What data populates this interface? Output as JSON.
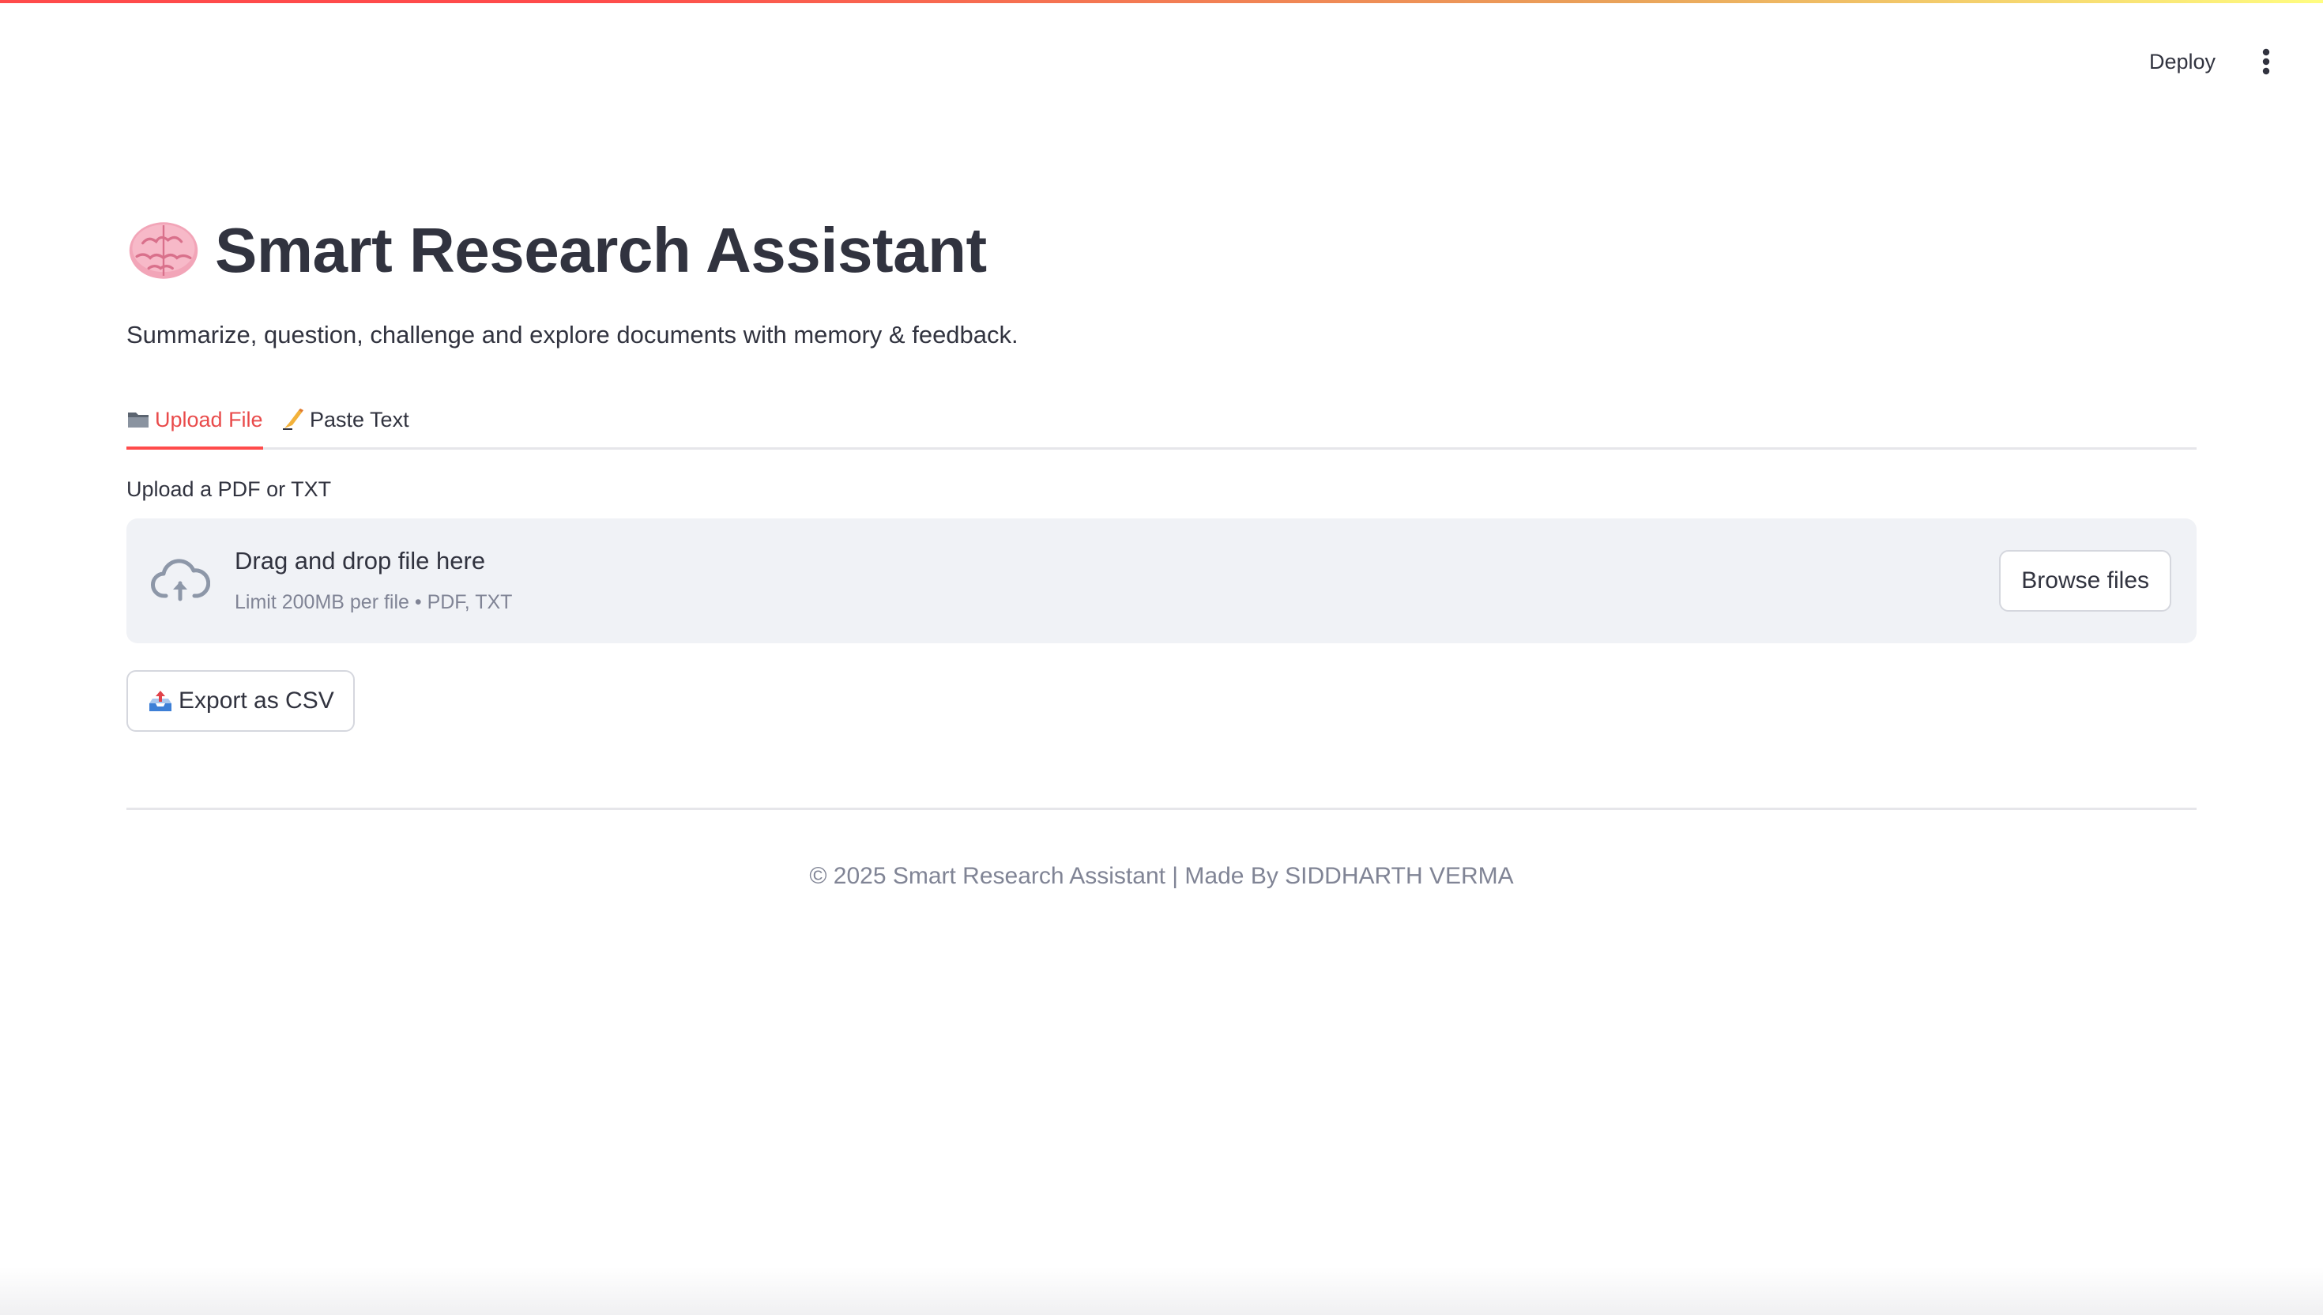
{
  "header": {
    "deploy_label": "Deploy",
    "menu_icon": "more-vertical-icon"
  },
  "app": {
    "title_icon": "brain-icon",
    "title": "Smart Research Assistant",
    "subtitle": "Summarize, question, challenge and explore documents with memory & feedback."
  },
  "tabs": [
    {
      "icon": "folder-icon",
      "label": "Upload File",
      "active": true
    },
    {
      "icon": "writing-hand-icon",
      "label": "Paste Text",
      "active": false
    }
  ],
  "uploader": {
    "label": "Upload a PDF or TXT",
    "drop_title": "Drag and drop file here",
    "limit_text": "Limit 200MB per file • PDF, TXT",
    "browse_label": "Browse files",
    "icon": "cloud-upload-icon"
  },
  "export": {
    "icon": "outbox-tray-icon",
    "label": "Export as CSV"
  },
  "footer": {
    "text": "© 2025 Smart Research Assistant | Made By SIDDHARTH VERMA"
  },
  "colors": {
    "accent": "#ff4b4b",
    "text": "#31333f",
    "muted": "#808495",
    "dropzone_bg": "#f0f2f6"
  }
}
